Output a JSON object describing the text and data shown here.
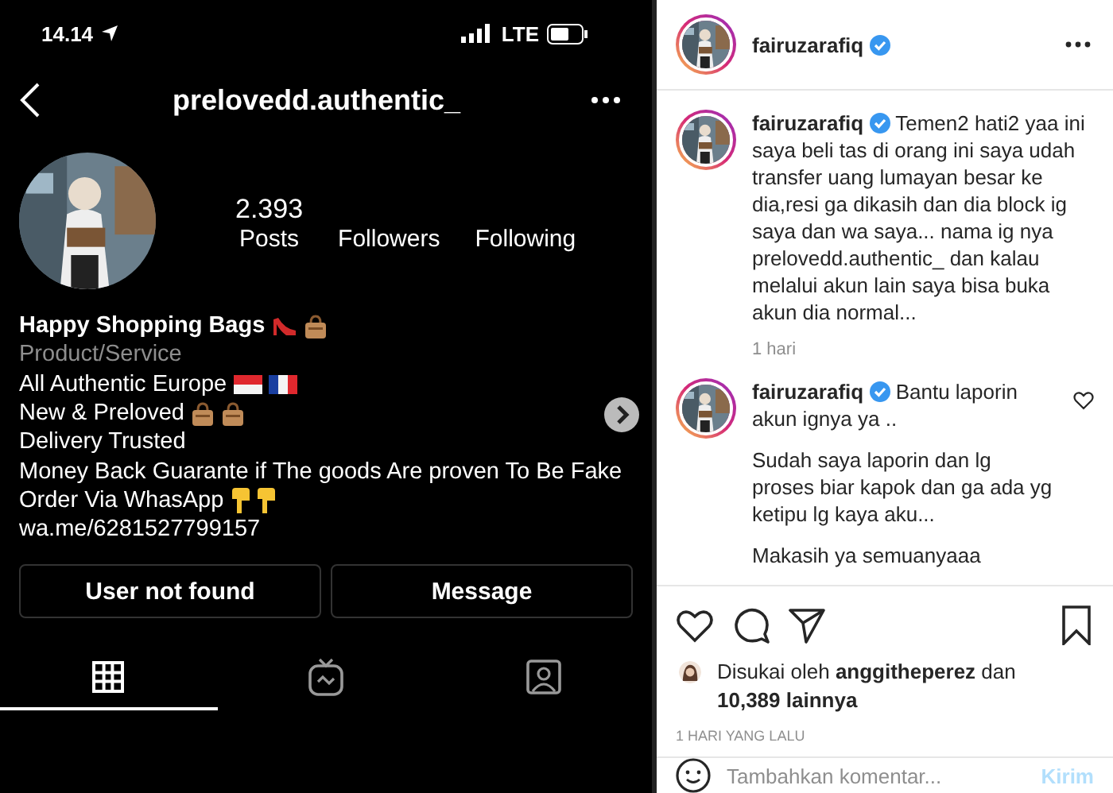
{
  "status_bar": {
    "time": "14.14",
    "network": "LTE"
  },
  "profile": {
    "username": "prelovedd.authentic_",
    "stats": [
      {
        "value": "2.393",
        "label": "Posts"
      },
      {
        "label": "Followers"
      },
      {
        "label": "Following"
      }
    ],
    "bio": [
      {
        "kind": "name",
        "text": "Happy Shopping Bags",
        "emoji": [
          {
            "kind": "heel"
          },
          {
            "kind": "handbag"
          }
        ]
      },
      {
        "kind": "category",
        "text": "Product/Service"
      },
      {
        "kind": "text",
        "text": "All Authentic Europe",
        "emoji": [
          {
            "kind": "flag-id"
          },
          {
            "kind": "flag-fr"
          }
        ]
      },
      {
        "kind": "text",
        "text": "New & Preloved",
        "emoji": [
          {
            "kind": "handbag"
          },
          {
            "kind": "handbag"
          }
        ]
      },
      {
        "kind": "text",
        "text": "Delivery Trusted"
      },
      {
        "kind": "text",
        "text": "Money Back Guarante if The goods Are proven To Be Fake"
      },
      {
        "kind": "text",
        "text": "Order Via WhasApp",
        "emoji": [
          {
            "kind": "point-down"
          },
          {
            "kind": "point-down"
          }
        ]
      },
      {
        "kind": "link",
        "text": "wa.me/6281527799157"
      }
    ],
    "buttons": [
      "User not found",
      "Message"
    ],
    "tabs": [
      {
        "kind": "grid",
        "selected": true
      },
      {
        "kind": "tv",
        "selected": false
      },
      {
        "kind": "tagged",
        "selected": false
      }
    ]
  },
  "post": {
    "author": "fairuzarafiq",
    "verified": true,
    "comments": [
      {
        "author": "fairuzarafiq",
        "verified": true,
        "paragraphs": [
          "Temen2 hati2 yaa ini saya beli tas di orang ini saya udah transfer uang lumayan besar ke dia,resi ga dikasih dan dia block ig saya dan wa saya... nama ig nya prelovedd.authentic_ dan kalau melalui akun lain saya bisa buka akun dia normal..."
        ],
        "time": "1 hari",
        "like_button": false
      },
      {
        "author": "fairuzarafiq",
        "verified": true,
        "paragraphs": [
          "Bantu laporin akun ignya ya ..",
          "Sudah saya laporin dan lg proses biar kapok dan ga ada yg ketipu lg kaya aku...",
          "Makasih ya semuanyaaa"
        ],
        "like_button": true
      }
    ],
    "likes": "Disukai oleh **anggitheperez** dan **10,389 lainnya**",
    "date": "1 HARI YANG LALU",
    "comment_box": {
      "placeholder": "Tambahkan komentar...",
      "button": "Kirim"
    }
  }
}
